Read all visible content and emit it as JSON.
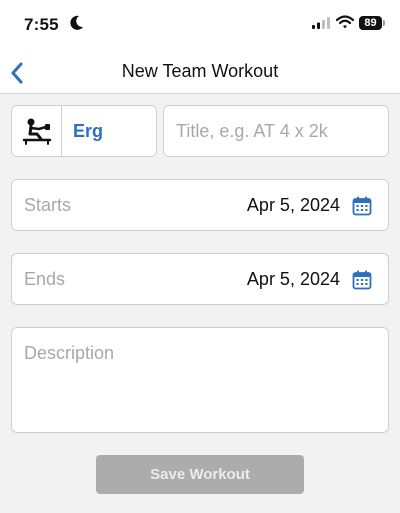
{
  "status_bar": {
    "time": "7:55",
    "battery_level": "89",
    "icons": [
      "moon-icon",
      "signal-icon",
      "wifi-icon",
      "battery-icon"
    ]
  },
  "nav": {
    "title": "New Team Workout",
    "back_icon": "chevron-left-icon"
  },
  "workout_type": {
    "icon": "rowing-erg-icon",
    "label": "Erg"
  },
  "title_input": {
    "value": "",
    "placeholder": "Title, e.g. AT 4 x 2k"
  },
  "starts": {
    "label": "Starts",
    "value": "Apr 5, 2024",
    "icon": "calendar-icon"
  },
  "ends": {
    "label": "Ends",
    "value": "Apr 5, 2024",
    "icon": "calendar-icon"
  },
  "description": {
    "value": "",
    "placeholder": "Description"
  },
  "save_button": {
    "label": "Save Workout",
    "enabled": false
  },
  "colors": {
    "accent": "#2f6fc1",
    "background": "#f2f2f2",
    "disabled_button": "#acacac"
  }
}
